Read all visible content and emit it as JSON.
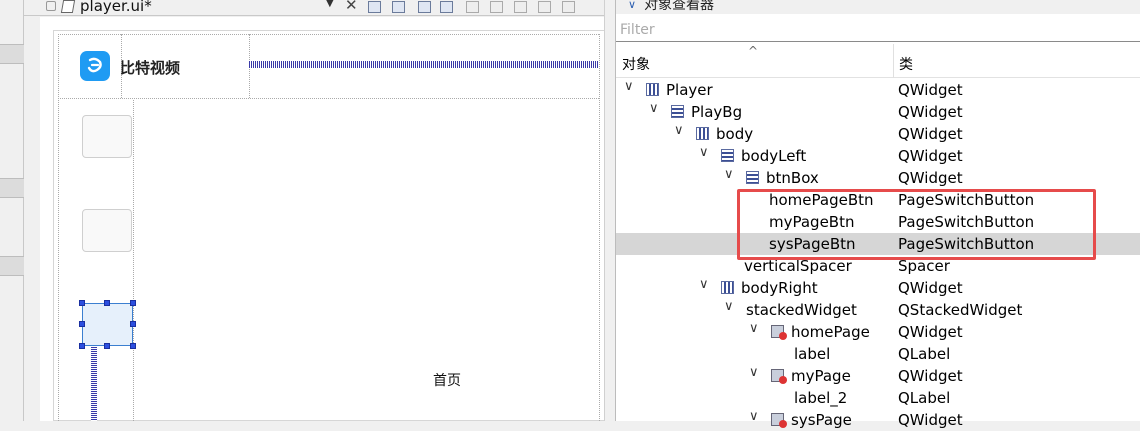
{
  "designer": {
    "file_tab": "player.ui*",
    "logo_text": "比特视频",
    "home_label": "首页"
  },
  "panel": {
    "title": "对象查看器",
    "filter_placeholder": "Filter",
    "col_object": "对象",
    "col_class": "类"
  },
  "tree": [
    {
      "name": "Player",
      "cls": "QWidget",
      "depth": 0,
      "expand": true,
      "icon": "vertical-layout-icon"
    },
    {
      "name": "PlayBg",
      "cls": "QWidget",
      "depth": 1,
      "expand": true,
      "icon": "horizontal-layout-icon"
    },
    {
      "name": "body",
      "cls": "QWidget",
      "depth": 2,
      "expand": true,
      "icon": "vertical-layout-icon"
    },
    {
      "name": "bodyLeft",
      "cls": "QWidget",
      "depth": 3,
      "expand": true,
      "icon": "horizontal-layout-icon"
    },
    {
      "name": "btnBox",
      "cls": "QWidget",
      "depth": 4,
      "expand": true,
      "icon": "horizontal-layout-icon"
    },
    {
      "name": "homePageBtn",
      "cls": "PageSwitchButton",
      "depth": 5,
      "expand": false,
      "icon": ""
    },
    {
      "name": "myPageBtn",
      "cls": "PageSwitchButton",
      "depth": 5,
      "expand": false,
      "icon": ""
    },
    {
      "name": "sysPageBtn",
      "cls": "PageSwitchButton",
      "depth": 5,
      "expand": false,
      "icon": "",
      "selected": true
    },
    {
      "name": "verticalSpacer",
      "cls": "Spacer",
      "depth": 4,
      "expand": false,
      "icon": ""
    },
    {
      "name": "bodyRight",
      "cls": "QWidget",
      "depth": 3,
      "expand": true,
      "icon": "vertical-layout-icon"
    },
    {
      "name": "stackedWidget",
      "cls": "QStackedWidget",
      "depth": 4,
      "expand": true,
      "icon": ""
    },
    {
      "name": "homePage",
      "cls": "QWidget",
      "depth": 5,
      "expand": true,
      "icon": "stacked-page-icon"
    },
    {
      "name": "label",
      "cls": "QLabel",
      "depth": 6,
      "expand": false,
      "icon": ""
    },
    {
      "name": "myPage",
      "cls": "QWidget",
      "depth": 5,
      "expand": true,
      "icon": "stacked-page-icon"
    },
    {
      "name": "label_2",
      "cls": "QLabel",
      "depth": 6,
      "expand": false,
      "icon": ""
    },
    {
      "name": "sysPage",
      "cls": "QWidget",
      "depth": 5,
      "expand": true,
      "icon": "stacked-page-icon"
    }
  ]
}
